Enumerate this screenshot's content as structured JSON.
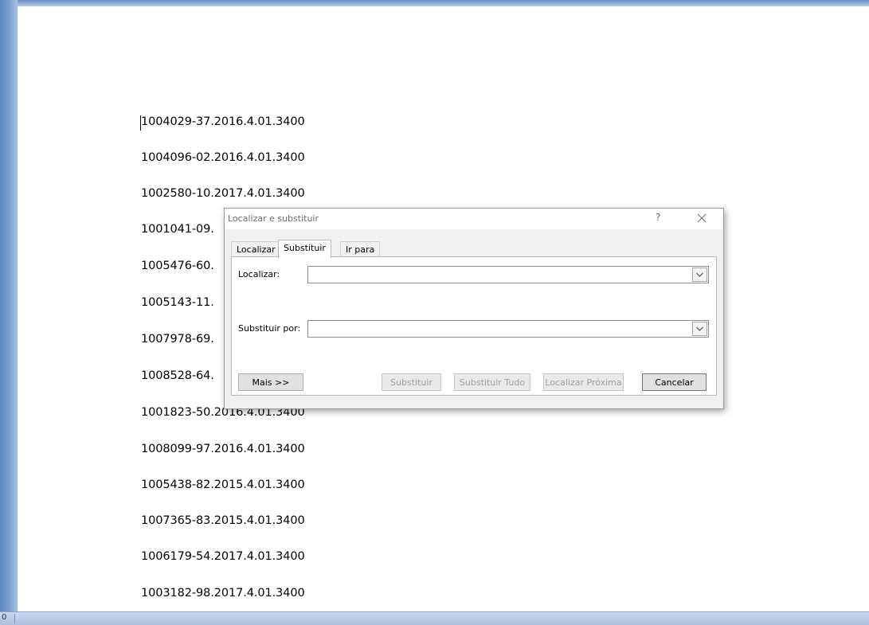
{
  "document": {
    "lines": [
      "1004029-37.2016.4.01.3400",
      "1004096-02.2016.4.01.3400",
      "1002580-10.2017.4.01.3400",
      "1001041-09.",
      "1005476-60.",
      "1005143-11.",
      "1007978-69.",
      "1008528-64.",
      "1001823-50.2016.4.01.3400",
      "1008099-97.2016.4.01.3400",
      "1005438-82.2015.4.01.3400",
      "1007365-83.2015.4.01.3400",
      "1006179-54.2017.4.01.3400",
      "1003182-98.2017.4.01.3400"
    ]
  },
  "dialog": {
    "title": "Localizar e substituir",
    "help": "?",
    "tabs": [
      {
        "label": "Localizar",
        "active": false
      },
      {
        "label": "Substituir",
        "active": true
      },
      {
        "label": "Ir para",
        "active": false
      }
    ],
    "find_label": "Localizar:",
    "find_value": "",
    "replace_label": "Substituir por:",
    "replace_value": "",
    "buttons": {
      "more": "Mais >>",
      "replace": "Substituir",
      "replace_all": "Substituir Tudo",
      "find_next": "Localizar Próxima",
      "cancel": "Cancelar"
    }
  },
  "status_bar": {
    "left_text": "0"
  }
}
